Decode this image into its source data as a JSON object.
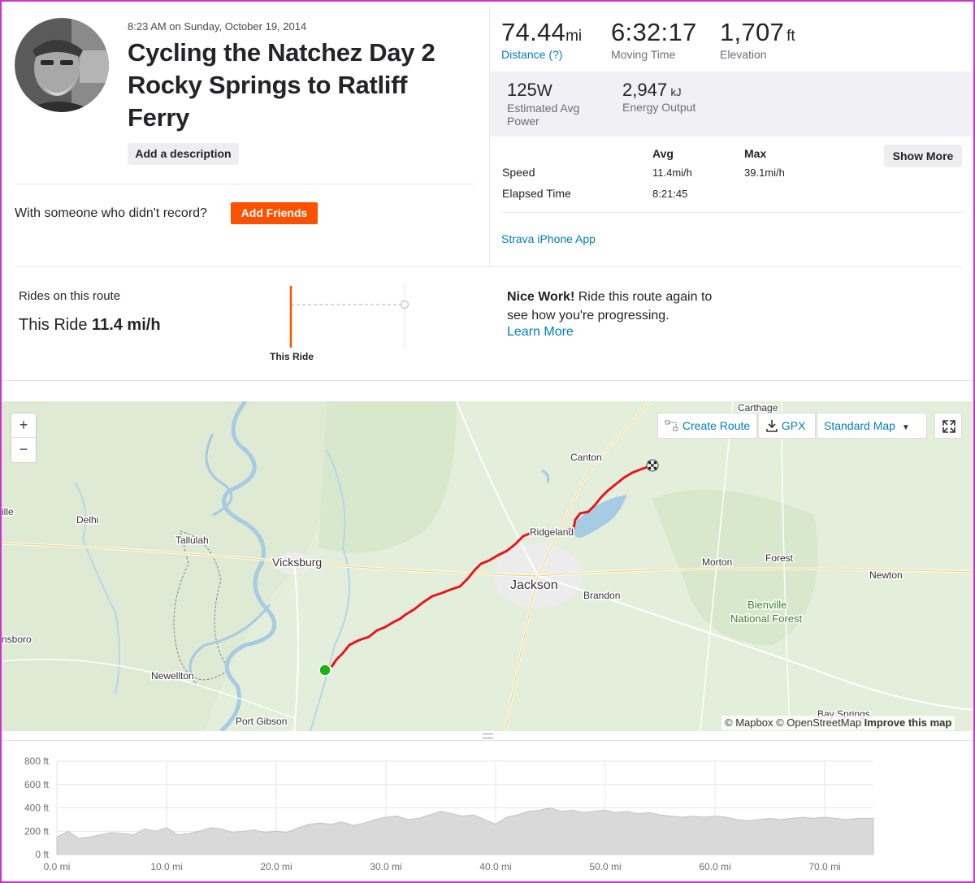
{
  "activity": {
    "date": "8:23 AM on Sunday, October 19, 2014",
    "title": "Cycling the Natchez Day 2 Rocky Springs to Ratliff Ferry",
    "add_description": "Add a description",
    "with_someone": "With someone who didn't record?",
    "add_friends": "Add Friends"
  },
  "stats": {
    "distance": {
      "value": "74.44",
      "unit": "mi",
      "label": "Distance (?)"
    },
    "moving_time": {
      "value": "6:32:17",
      "label": "Moving Time"
    },
    "elevation": {
      "value": "1,707",
      "unit": "ft",
      "label": "Elevation"
    },
    "power": {
      "value": "125",
      "unit": "W",
      "label": "Estimated Avg Power"
    },
    "energy": {
      "value": "2,947",
      "unit": "kJ",
      "label": "Energy Output"
    }
  },
  "table": {
    "avg_header": "Avg",
    "max_header": "Max",
    "show_more": "Show More",
    "rows": [
      {
        "label": "Speed",
        "avg": "11.4mi/h",
        "max": "39.1mi/h"
      },
      {
        "label": "Elapsed Time",
        "avg": "8:21:45",
        "max": ""
      }
    ]
  },
  "device": "Strava iPhone App",
  "route": {
    "rides_label": "Rides on this route",
    "this_ride_prefix": "This Ride",
    "this_ride_speed": "11.4 mi/h",
    "chart_label": "This Ride",
    "nice_bold": "Nice Work!",
    "nice_text": "Ride this route again to see how you're progressing.",
    "learn_more": "Learn More"
  },
  "map": {
    "zoom_in": "+",
    "zoom_out": "−",
    "create_route": "Create Route",
    "gpx": "GPX",
    "map_type": "Standard Map",
    "attribution_mapbox": "© Mapbox",
    "attribution_osm": "© OpenStreetMap",
    "improve": "Improve this map",
    "places": {
      "carthage": "Carthage",
      "canton": "Canton",
      "ille": "ille",
      "delhi": "Delhi",
      "tallulah": "Tallulah",
      "ridgeland": "Ridgeland",
      "vicksburg": "Vicksburg",
      "morton": "Morton",
      "forest": "Forest",
      "newton": "Newton",
      "jackson": "Jackson",
      "brandon": "Brandon",
      "bienville": "Bienville",
      "national_forest": "National Forest",
      "nsboro": "nsboro",
      "newellton": "Newellton",
      "port_gibson": "Port Gibson",
      "bay_springs": "Bay Springs"
    },
    "route_color": "#e8141e",
    "start_color": "#19b312"
  },
  "chart_data": {
    "type": "area",
    "title": "",
    "xlabel": "",
    "ylabel": "",
    "x_unit": "mi",
    "y_unit": "ft",
    "xlim": [
      0,
      74.44
    ],
    "ylim": [
      0,
      800
    ],
    "x_ticks": [
      "0.0 mi",
      "10.0 mi",
      "20.0 mi",
      "30.0 mi",
      "40.0 mi",
      "50.0 mi",
      "60.0 mi",
      "70.0 mi"
    ],
    "y_ticks": [
      "0 ft",
      "200 ft",
      "400 ft",
      "600 ft",
      "800 ft"
    ],
    "x": [
      0,
      1,
      2,
      3,
      4,
      5,
      6,
      7,
      8,
      9,
      10,
      11,
      12,
      13,
      14,
      15,
      16,
      17,
      18,
      19,
      20,
      21,
      22,
      23,
      24,
      25,
      26,
      27,
      28,
      29,
      30,
      31,
      32,
      33,
      34,
      35,
      36,
      37,
      38,
      39,
      40,
      41,
      42,
      43,
      44,
      45,
      46,
      47,
      48,
      49,
      50,
      51,
      52,
      53,
      54,
      55,
      56,
      57,
      58,
      59,
      60,
      61,
      62,
      63,
      64,
      65,
      66,
      67,
      68,
      69,
      70,
      71,
      72,
      73,
      74.44
    ],
    "y": [
      150,
      200,
      140,
      150,
      170,
      190,
      180,
      170,
      220,
      200,
      230,
      170,
      180,
      200,
      230,
      220,
      190,
      200,
      210,
      190,
      200,
      190,
      230,
      260,
      270,
      260,
      280,
      250,
      270,
      300,
      320,
      330,
      300,
      310,
      340,
      370,
      350,
      330,
      340,
      300,
      260,
      320,
      340,
      370,
      380,
      400,
      370,
      380,
      360,
      370,
      380,
      360,
      370,
      350,
      360,
      340,
      330,
      320,
      330,
      320,
      330,
      320,
      300,
      290,
      300,
      310,
      300,
      310,
      320,
      310,
      320,
      310,
      300,
      310,
      310
    ],
    "fill": "#d9d9d9",
    "grid": true
  }
}
